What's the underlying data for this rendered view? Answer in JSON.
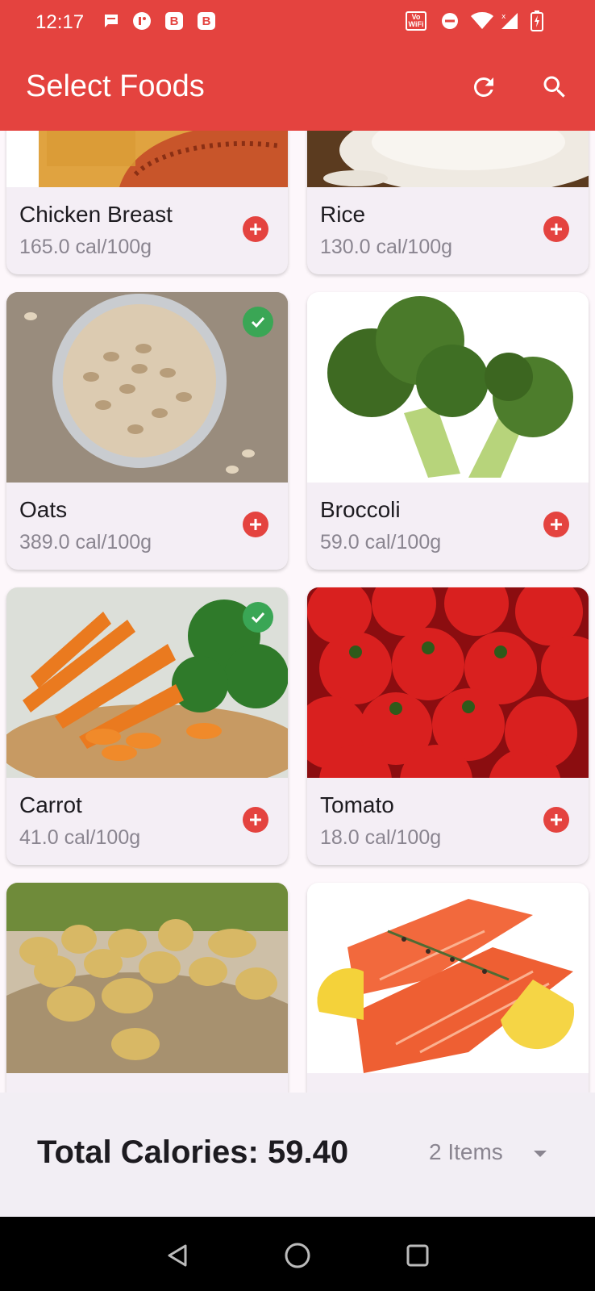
{
  "status_bar": {
    "time": "12:17",
    "badge_1": "B",
    "badge_2": "B",
    "vowifi_top": "Vo",
    "vowifi_bottom": "WiFi",
    "icons": [
      "message-icon",
      "app-icon",
      "b-badge-icon",
      "b-badge-icon",
      "vowifi-icon",
      "dnd-icon",
      "wifi-icon",
      "signal-icon",
      "battery-charging-icon"
    ]
  },
  "app_bar": {
    "title": "Select Foods",
    "actions": [
      "refresh-icon",
      "search-icon"
    ],
    "color": "#e4433f"
  },
  "foods": [
    {
      "name": "Chicken Breast",
      "calories": "165.0 cal/100g",
      "selected": false,
      "image": "chicken-breast-photo"
    },
    {
      "name": "Rice",
      "calories": "130.0 cal/100g",
      "selected": false,
      "image": "rice-photo"
    },
    {
      "name": "Oats",
      "calories": "389.0 cal/100g",
      "selected": true,
      "image": "oats-photo"
    },
    {
      "name": "Broccoli",
      "calories": "59.0 cal/100g",
      "selected": false,
      "image": "broccoli-photo"
    },
    {
      "name": "Carrot",
      "calories": "41.0 cal/100g",
      "selected": true,
      "image": "carrot-photo"
    },
    {
      "name": "Tomato",
      "calories": "18.0 cal/100g",
      "selected": false,
      "image": "tomato-photo"
    },
    {
      "name": "",
      "calories": "",
      "selected": false,
      "image": "potato-photo"
    },
    {
      "name": "",
      "calories": "",
      "selected": false,
      "image": "salmon-photo"
    }
  ],
  "summary": {
    "total_label": "Total Calories: 59.40",
    "items_label": "2 Items"
  },
  "colors": {
    "accent": "#e4433f",
    "check": "#3aa655",
    "card_bg": "#f4eef5"
  }
}
